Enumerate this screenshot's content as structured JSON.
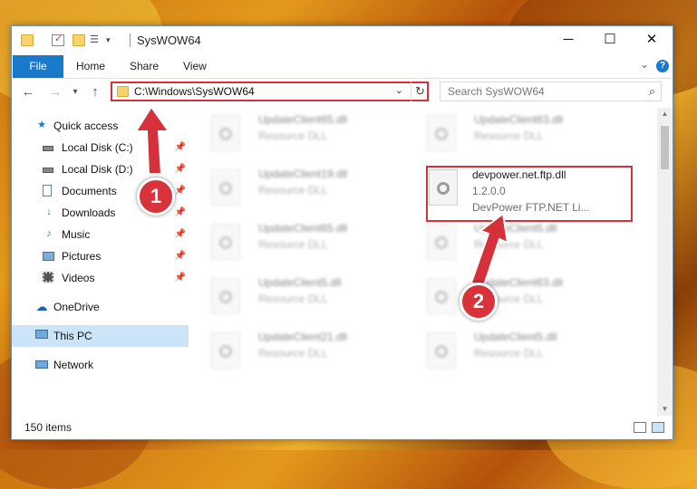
{
  "window": {
    "title": "SysWOW64",
    "controls": {
      "minimize": "─",
      "maximize": "☐",
      "close": "✕"
    }
  },
  "ribbon": {
    "tabs": [
      "File",
      "Home",
      "Share",
      "View"
    ],
    "help": "?"
  },
  "nav": {
    "back": "←",
    "forward": "→",
    "recent": "▾",
    "up": "↑",
    "address": "C:\\Windows\\SysWOW64",
    "refresh": "↻",
    "search_placeholder": "Search SysWOW64"
  },
  "sidebar": {
    "items": [
      {
        "label": "Quick access",
        "icon": "star-icon"
      },
      {
        "label": "Local Disk (C:)",
        "icon": "drive-icon",
        "pinned": true
      },
      {
        "label": "Local Disk (D:)",
        "icon": "drive-icon",
        "pinned": true
      },
      {
        "label": "Documents",
        "icon": "documents-icon",
        "pinned": true
      },
      {
        "label": "Downloads",
        "icon": "downloads-icon",
        "pinned": true
      },
      {
        "label": "Music",
        "icon": "music-icon",
        "pinned": true
      },
      {
        "label": "Pictures",
        "icon": "pictures-icon",
        "pinned": true
      },
      {
        "label": "Videos",
        "icon": "videos-icon",
        "pinned": true
      },
      {
        "label": "OneDrive",
        "icon": "cloud-icon"
      },
      {
        "label": "This PC",
        "icon": "computer-icon",
        "selected": true
      },
      {
        "label": "Network",
        "icon": "network-icon"
      }
    ]
  },
  "files": {
    "left_column": [
      {
        "name": "UpdateClient65.dll",
        "type": "Resource DLL"
      },
      {
        "name": "UpdateClient19.dll",
        "type": "Resource DLL"
      },
      {
        "name": "UpdateClient65.dll",
        "type": "Resource DLL"
      },
      {
        "name": "UpdateClient5.dll",
        "type": "Resource DLL"
      },
      {
        "name": "UpdateClient21.dll",
        "type": "Resource DLL"
      }
    ],
    "right_column": [
      {
        "name": "UpdateClient63.dll",
        "type": "Resource DLL"
      },
      {
        "name": "UpdateClient5.dll",
        "type": "Resource DLL"
      },
      {
        "name": "UpdateClient63.dll",
        "type": "Resource DLL"
      },
      {
        "name": "UpdateClient5.dll",
        "type": "Resource DLL"
      }
    ],
    "highlighted": {
      "name": "devpower.net.ftp.dll",
      "version": "1.2.0.0",
      "description": "DevPower FTP.NET Li..."
    }
  },
  "status": {
    "item_count": "150 items"
  },
  "callouts": {
    "step1": "1",
    "step2": "2"
  },
  "colors": {
    "accent": "#1979ca",
    "highlight_red": "#d6303a",
    "selected_bg": "#cce4f7"
  }
}
